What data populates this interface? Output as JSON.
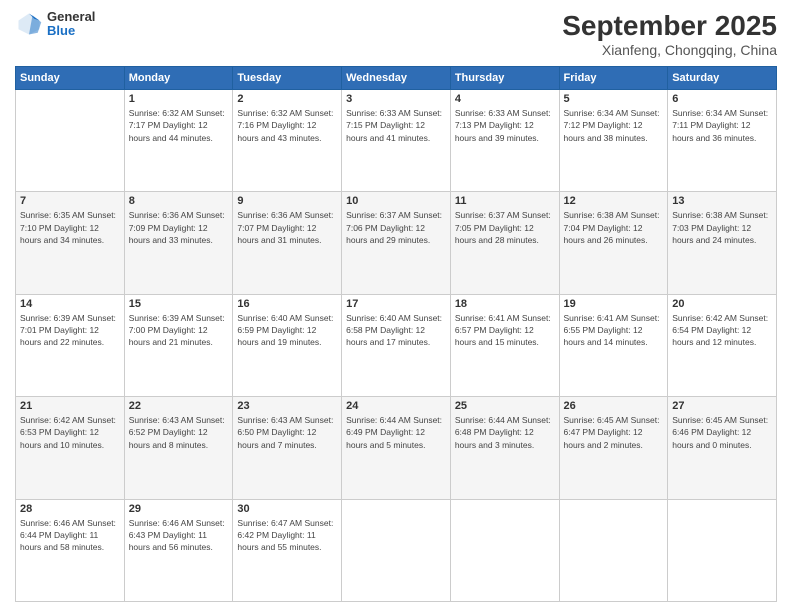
{
  "header": {
    "logo_general": "General",
    "logo_blue": "Blue",
    "title": "September 2025",
    "location": "Xianfeng, Chongqing, China"
  },
  "weekdays": [
    "Sunday",
    "Monday",
    "Tuesday",
    "Wednesday",
    "Thursday",
    "Friday",
    "Saturday"
  ],
  "weeks": [
    [
      {
        "day": "",
        "info": ""
      },
      {
        "day": "1",
        "info": "Sunrise: 6:32 AM\nSunset: 7:17 PM\nDaylight: 12 hours\nand 44 minutes."
      },
      {
        "day": "2",
        "info": "Sunrise: 6:32 AM\nSunset: 7:16 PM\nDaylight: 12 hours\nand 43 minutes."
      },
      {
        "day": "3",
        "info": "Sunrise: 6:33 AM\nSunset: 7:15 PM\nDaylight: 12 hours\nand 41 minutes."
      },
      {
        "day": "4",
        "info": "Sunrise: 6:33 AM\nSunset: 7:13 PM\nDaylight: 12 hours\nand 39 minutes."
      },
      {
        "day": "5",
        "info": "Sunrise: 6:34 AM\nSunset: 7:12 PM\nDaylight: 12 hours\nand 38 minutes."
      },
      {
        "day": "6",
        "info": "Sunrise: 6:34 AM\nSunset: 7:11 PM\nDaylight: 12 hours\nand 36 minutes."
      }
    ],
    [
      {
        "day": "7",
        "info": "Sunrise: 6:35 AM\nSunset: 7:10 PM\nDaylight: 12 hours\nand 34 minutes."
      },
      {
        "day": "8",
        "info": "Sunrise: 6:36 AM\nSunset: 7:09 PM\nDaylight: 12 hours\nand 33 minutes."
      },
      {
        "day": "9",
        "info": "Sunrise: 6:36 AM\nSunset: 7:07 PM\nDaylight: 12 hours\nand 31 minutes."
      },
      {
        "day": "10",
        "info": "Sunrise: 6:37 AM\nSunset: 7:06 PM\nDaylight: 12 hours\nand 29 minutes."
      },
      {
        "day": "11",
        "info": "Sunrise: 6:37 AM\nSunset: 7:05 PM\nDaylight: 12 hours\nand 28 minutes."
      },
      {
        "day": "12",
        "info": "Sunrise: 6:38 AM\nSunset: 7:04 PM\nDaylight: 12 hours\nand 26 minutes."
      },
      {
        "day": "13",
        "info": "Sunrise: 6:38 AM\nSunset: 7:03 PM\nDaylight: 12 hours\nand 24 minutes."
      }
    ],
    [
      {
        "day": "14",
        "info": "Sunrise: 6:39 AM\nSunset: 7:01 PM\nDaylight: 12 hours\nand 22 minutes."
      },
      {
        "day": "15",
        "info": "Sunrise: 6:39 AM\nSunset: 7:00 PM\nDaylight: 12 hours\nand 21 minutes."
      },
      {
        "day": "16",
        "info": "Sunrise: 6:40 AM\nSunset: 6:59 PM\nDaylight: 12 hours\nand 19 minutes."
      },
      {
        "day": "17",
        "info": "Sunrise: 6:40 AM\nSunset: 6:58 PM\nDaylight: 12 hours\nand 17 minutes."
      },
      {
        "day": "18",
        "info": "Sunrise: 6:41 AM\nSunset: 6:57 PM\nDaylight: 12 hours\nand 15 minutes."
      },
      {
        "day": "19",
        "info": "Sunrise: 6:41 AM\nSunset: 6:55 PM\nDaylight: 12 hours\nand 14 minutes."
      },
      {
        "day": "20",
        "info": "Sunrise: 6:42 AM\nSunset: 6:54 PM\nDaylight: 12 hours\nand 12 minutes."
      }
    ],
    [
      {
        "day": "21",
        "info": "Sunrise: 6:42 AM\nSunset: 6:53 PM\nDaylight: 12 hours\nand 10 minutes."
      },
      {
        "day": "22",
        "info": "Sunrise: 6:43 AM\nSunset: 6:52 PM\nDaylight: 12 hours\nand 8 minutes."
      },
      {
        "day": "23",
        "info": "Sunrise: 6:43 AM\nSunset: 6:50 PM\nDaylight: 12 hours\nand 7 minutes."
      },
      {
        "day": "24",
        "info": "Sunrise: 6:44 AM\nSunset: 6:49 PM\nDaylight: 12 hours\nand 5 minutes."
      },
      {
        "day": "25",
        "info": "Sunrise: 6:44 AM\nSunset: 6:48 PM\nDaylight: 12 hours\nand 3 minutes."
      },
      {
        "day": "26",
        "info": "Sunrise: 6:45 AM\nSunset: 6:47 PM\nDaylight: 12 hours\nand 2 minutes."
      },
      {
        "day": "27",
        "info": "Sunrise: 6:45 AM\nSunset: 6:46 PM\nDaylight: 12 hours\nand 0 minutes."
      }
    ],
    [
      {
        "day": "28",
        "info": "Sunrise: 6:46 AM\nSunset: 6:44 PM\nDaylight: 11 hours\nand 58 minutes."
      },
      {
        "day": "29",
        "info": "Sunrise: 6:46 AM\nSunset: 6:43 PM\nDaylight: 11 hours\nand 56 minutes."
      },
      {
        "day": "30",
        "info": "Sunrise: 6:47 AM\nSunset: 6:42 PM\nDaylight: 11 hours\nand 55 minutes."
      },
      {
        "day": "",
        "info": ""
      },
      {
        "day": "",
        "info": ""
      },
      {
        "day": "",
        "info": ""
      },
      {
        "day": "",
        "info": ""
      }
    ]
  ]
}
